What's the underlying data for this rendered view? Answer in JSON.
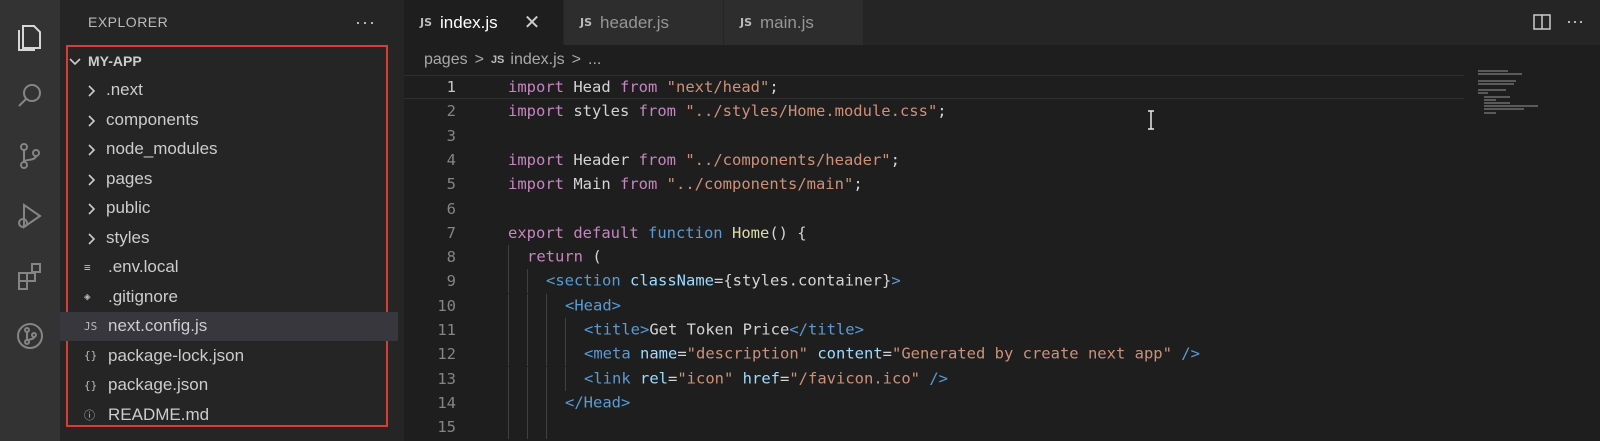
{
  "activity_bar": {
    "items": [
      {
        "icon": "explorer-icon"
      },
      {
        "icon": "search-icon"
      },
      {
        "icon": "source-control-icon"
      },
      {
        "icon": "run-debug-icon"
      },
      {
        "icon": "extensions-icon"
      },
      {
        "icon": "git-graph-icon"
      }
    ]
  },
  "sidebar": {
    "title": "EXPLORER",
    "more_label": "···",
    "root": "MY-APP",
    "items": [
      {
        "label": ".next",
        "type": "folder"
      },
      {
        "label": "components",
        "type": "folder"
      },
      {
        "label": "node_modules",
        "type": "folder"
      },
      {
        "label": "pages",
        "type": "folder"
      },
      {
        "label": "public",
        "type": "folder"
      },
      {
        "label": "styles",
        "type": "folder"
      },
      {
        "label": ".env.local",
        "type": "file",
        "icon": "≡"
      },
      {
        "label": ".gitignore",
        "type": "file",
        "icon": "◈"
      },
      {
        "label": "next.config.js",
        "type": "file",
        "icon": "JS",
        "selected": true
      },
      {
        "label": "package-lock.json",
        "type": "file",
        "icon": "{}"
      },
      {
        "label": "package.json",
        "type": "file",
        "icon": "{}"
      },
      {
        "label": "README.md",
        "type": "file",
        "icon": "ⓘ"
      }
    ]
  },
  "tabs": [
    {
      "badge": "JS",
      "label": "index.js",
      "active": true,
      "close": "✕"
    },
    {
      "badge": "JS",
      "label": "header.js",
      "active": false
    },
    {
      "badge": "JS",
      "label": "main.js",
      "active": false
    }
  ],
  "editor_actions": {
    "more_label": "···"
  },
  "breadcrumb": {
    "segments": [
      "pages",
      "index.js",
      "..."
    ],
    "separator": ">",
    "badge": "JS"
  },
  "code": {
    "current_line": 1,
    "lines": [
      {
        "n": "1",
        "tokens": [
          [
            "kw",
            "import "
          ],
          [
            "src",
            "Head "
          ],
          [
            "kw",
            "from "
          ],
          [
            "str",
            "\"next/head\""
          ],
          [
            "src",
            ";"
          ]
        ]
      },
      {
        "n": "2",
        "tokens": [
          [
            "kw",
            "import "
          ],
          [
            "src",
            "styles "
          ],
          [
            "kw",
            "from "
          ],
          [
            "str",
            "\"../styles/Home.module.css\""
          ],
          [
            "src",
            ";"
          ]
        ]
      },
      {
        "n": "3",
        "tokens": []
      },
      {
        "n": "4",
        "tokens": [
          [
            "kw",
            "import "
          ],
          [
            "src",
            "Header "
          ],
          [
            "kw",
            "from "
          ],
          [
            "str",
            "\"../components/header\""
          ],
          [
            "src",
            ";"
          ]
        ]
      },
      {
        "n": "5",
        "tokens": [
          [
            "kw",
            "import "
          ],
          [
            "src",
            "Main "
          ],
          [
            "kw",
            "from "
          ],
          [
            "str",
            "\"../components/main\""
          ],
          [
            "src",
            ";"
          ]
        ]
      },
      {
        "n": "6",
        "tokens": []
      },
      {
        "n": "7",
        "tokens": [
          [
            "kw",
            "export "
          ],
          [
            "kw",
            "default "
          ],
          [
            "kw2",
            "function "
          ],
          [
            "fn",
            "Home"
          ],
          [
            "src",
            "() {"
          ]
        ]
      },
      {
        "n": "8",
        "indent": 1,
        "tokens": [
          [
            "kw",
            "return "
          ],
          [
            "src",
            "("
          ]
        ]
      },
      {
        "n": "9",
        "indent": 2,
        "tokens": [
          [
            "tag",
            "<section "
          ],
          [
            "attr",
            "className"
          ],
          [
            "src",
            "={styles.container}"
          ],
          [
            "tag",
            ">"
          ]
        ]
      },
      {
        "n": "10",
        "indent": 3,
        "tokens": [
          [
            "tag",
            "<Head>"
          ]
        ]
      },
      {
        "n": "11",
        "indent": 4,
        "tokens": [
          [
            "tag",
            "<title>"
          ],
          [
            "src",
            "Get Token Price"
          ],
          [
            "tag",
            "</title>"
          ]
        ]
      },
      {
        "n": "12",
        "indent": 4,
        "tokens": [
          [
            "tag",
            "<meta "
          ],
          [
            "attr",
            "name"
          ],
          [
            "src",
            "="
          ],
          [
            "str",
            "\"description\" "
          ],
          [
            "attr",
            "content"
          ],
          [
            "src",
            "="
          ],
          [
            "str",
            "\"Generated by create next app\" "
          ],
          [
            "tag",
            "/>"
          ]
        ]
      },
      {
        "n": "13",
        "indent": 4,
        "tokens": [
          [
            "tag",
            "<link "
          ],
          [
            "attr",
            "rel"
          ],
          [
            "src",
            "="
          ],
          [
            "str",
            "\"icon\" "
          ],
          [
            "attr",
            "href"
          ],
          [
            "src",
            "="
          ],
          [
            "str",
            "\"/favicon.ico\" "
          ],
          [
            "tag",
            "/>"
          ]
        ]
      },
      {
        "n": "14",
        "indent": 3,
        "tokens": [
          [
            "tag",
            "</Head>"
          ]
        ]
      },
      {
        "n": "15",
        "indent": 3,
        "tokens": []
      }
    ]
  },
  "colors": {
    "selection_outline": "#e03a2f",
    "activity_bar": "#333333",
    "sidebar": "#252526",
    "editor": "#1e1e1e"
  }
}
